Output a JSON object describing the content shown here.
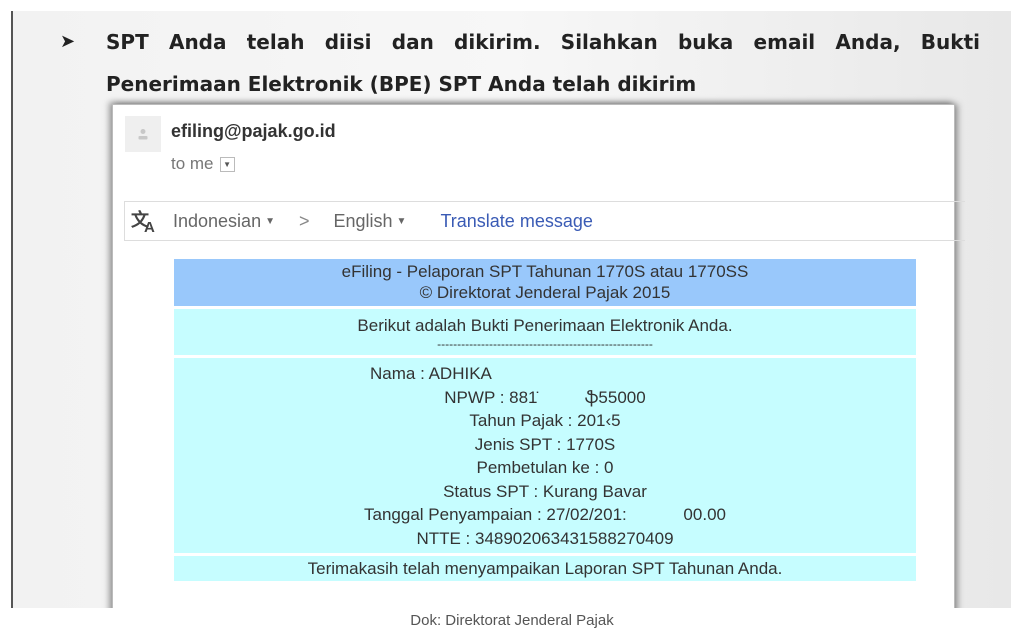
{
  "slide": {
    "bullet_icon": "arrow-bullet-icon",
    "bullet_line1": "SPT Anda telah diisi dan dikirim. Silahkan buka email Anda, Bukti",
    "bullet_line2": "Penerimaan Elektronik (BPE) SPT Anda telah dikirim"
  },
  "email": {
    "sender": "efiling@pajak.go.id",
    "recipient": "to me",
    "translate": {
      "from_lang": "Indonesian",
      "separator": ">",
      "to_lang": "English",
      "action": "Translate message"
    },
    "bpe": {
      "header_line1": "eFiling - Pelaporan SPT Tahunan 1770S atau 1770SS",
      "header_line2": "© Direktorat Jenderal Pajak 2015",
      "intro": "Berikut adalah Bukti Penerimaan Elektronik Anda.",
      "divider": "------------------------------------------------------",
      "details": [
        {
          "label": "Nama",
          "value": "ADHIKA",
          "text": "Nama : ADHIKA"
        },
        {
          "label": "NPWP",
          "value": "8817          55000",
          "text": "NPWP : 881̇          ֆ55000"
        },
        {
          "label": "Tahun Pajak",
          "value": "2015",
          "text": "Tahun Pajak : 201‹5"
        },
        {
          "label": "Jenis SPT",
          "value": "1770S",
          "text": "Jenis SPT : 1770S"
        },
        {
          "label": "Pembetulan ke",
          "value": "0",
          "text": "Pembetulan ke : 0"
        },
        {
          "label": "Status SPT",
          "value": "Kurang Bavar",
          "text": "Status SPT : Kurang Bavar"
        },
        {
          "label": "Tanggal Penyampaian",
          "value": "27/02/201:          00.00",
          "text": "Tanggal Penyampaian : 27/02/201:            00.00"
        },
        {
          "label": "NTTE",
          "value": "348902063431588270409",
          "text": "NTTE : 348902063431588270409"
        }
      ],
      "thanks": "Terimakasih telah menyampaikan Laporan SPT Tahunan Anda."
    }
  },
  "caption": "Dok: Direktorat Jenderal Pajak",
  "colors": {
    "header_blue": "#99c8fb",
    "body_cyan": "#c6fdff",
    "link_blue": "#3a5bb5"
  }
}
